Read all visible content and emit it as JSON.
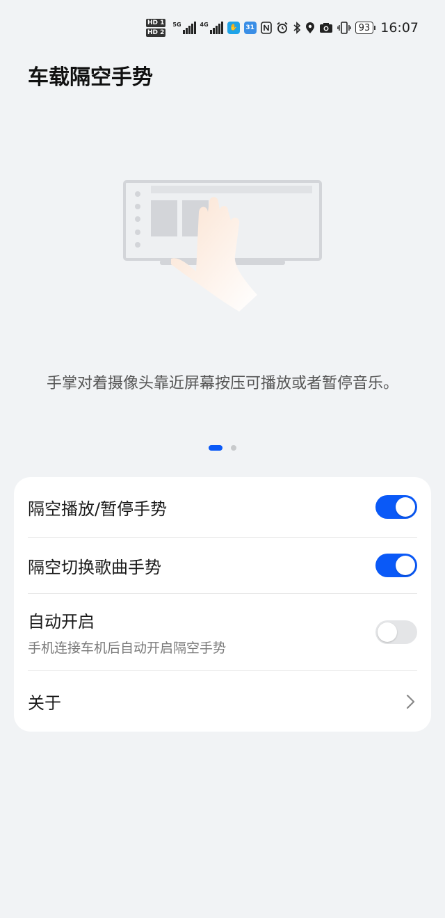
{
  "status_bar": {
    "hd1": "HD 1",
    "hd2": "HD 2",
    "net1": "5G",
    "net2": "4G",
    "calendar_badge": "31",
    "battery": "93",
    "time": "16:07",
    "icons": [
      "hd-icon",
      "signal-5g-icon",
      "signal-4g-icon",
      "app-hand-icon",
      "calendar-icon",
      "nfc-icon",
      "alarm-icon",
      "bluetooth-icon",
      "location-icon",
      "camera-icon",
      "vibrate-icon",
      "battery-icon"
    ]
  },
  "page": {
    "title": "车载隔空手势",
    "description": "手掌对着摄像头靠近屏幕按压可播放或者暂停音乐。",
    "pager": {
      "count": 2,
      "active": 0
    }
  },
  "settings": [
    {
      "label": "隔空播放/暂停手势",
      "type": "toggle",
      "on": true
    },
    {
      "label": "隔空切换歌曲手势",
      "type": "toggle",
      "on": true
    },
    {
      "label": "自动开启",
      "sublabel": "手机连接车机后自动开启隔空手势",
      "type": "toggle",
      "on": false
    },
    {
      "label": "关于",
      "type": "link"
    }
  ],
  "colors": {
    "accent": "#0a59f7",
    "background": "#f1f3f5",
    "card": "#ffffff",
    "toggle_off": "#e4e5e7"
  }
}
